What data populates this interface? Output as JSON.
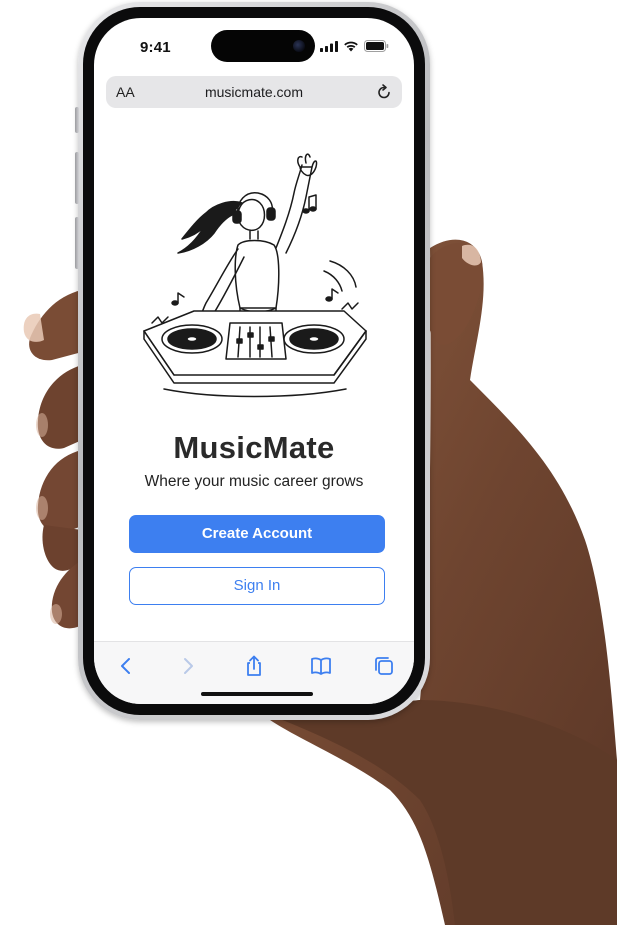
{
  "status_bar": {
    "time": "9:41"
  },
  "address_bar": {
    "text_size_label": "AA",
    "url": "musicmate.com",
    "reload_icon": "reload-icon"
  },
  "app": {
    "title": "MusicMate",
    "tagline": "Where your music career grows",
    "create_account_label": "Create Account",
    "sign_in_label": "Sign In",
    "illustration": "dj-girl-illustration"
  },
  "toolbar": {
    "icons": [
      "chevron-left-icon",
      "chevron-right-icon",
      "share-icon",
      "bookmarks-icon",
      "tabs-icon"
    ]
  },
  "colors": {
    "accent": "#3D7FF0",
    "title": "#2A2A2A",
    "toolbar_bg": "#F7F7F8"
  }
}
